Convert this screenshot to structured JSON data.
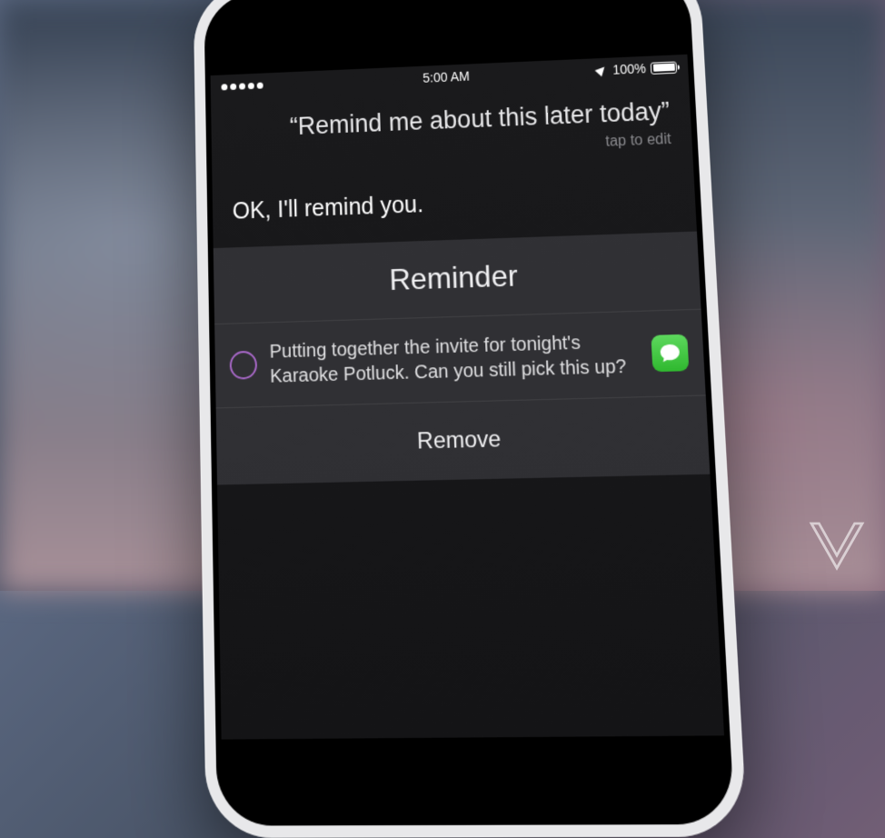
{
  "status_bar": {
    "time": "5:00 AM",
    "battery_percent": "100%"
  },
  "siri": {
    "query": "Remind me about this later today",
    "tap_hint": "tap to edit",
    "response": "OK, I'll remind you."
  },
  "reminder": {
    "title": "Reminder",
    "item_text": "Putting together the invite for tonight's Karaoke Potluck. Can you still pick this up?",
    "remove_label": "Remove"
  }
}
